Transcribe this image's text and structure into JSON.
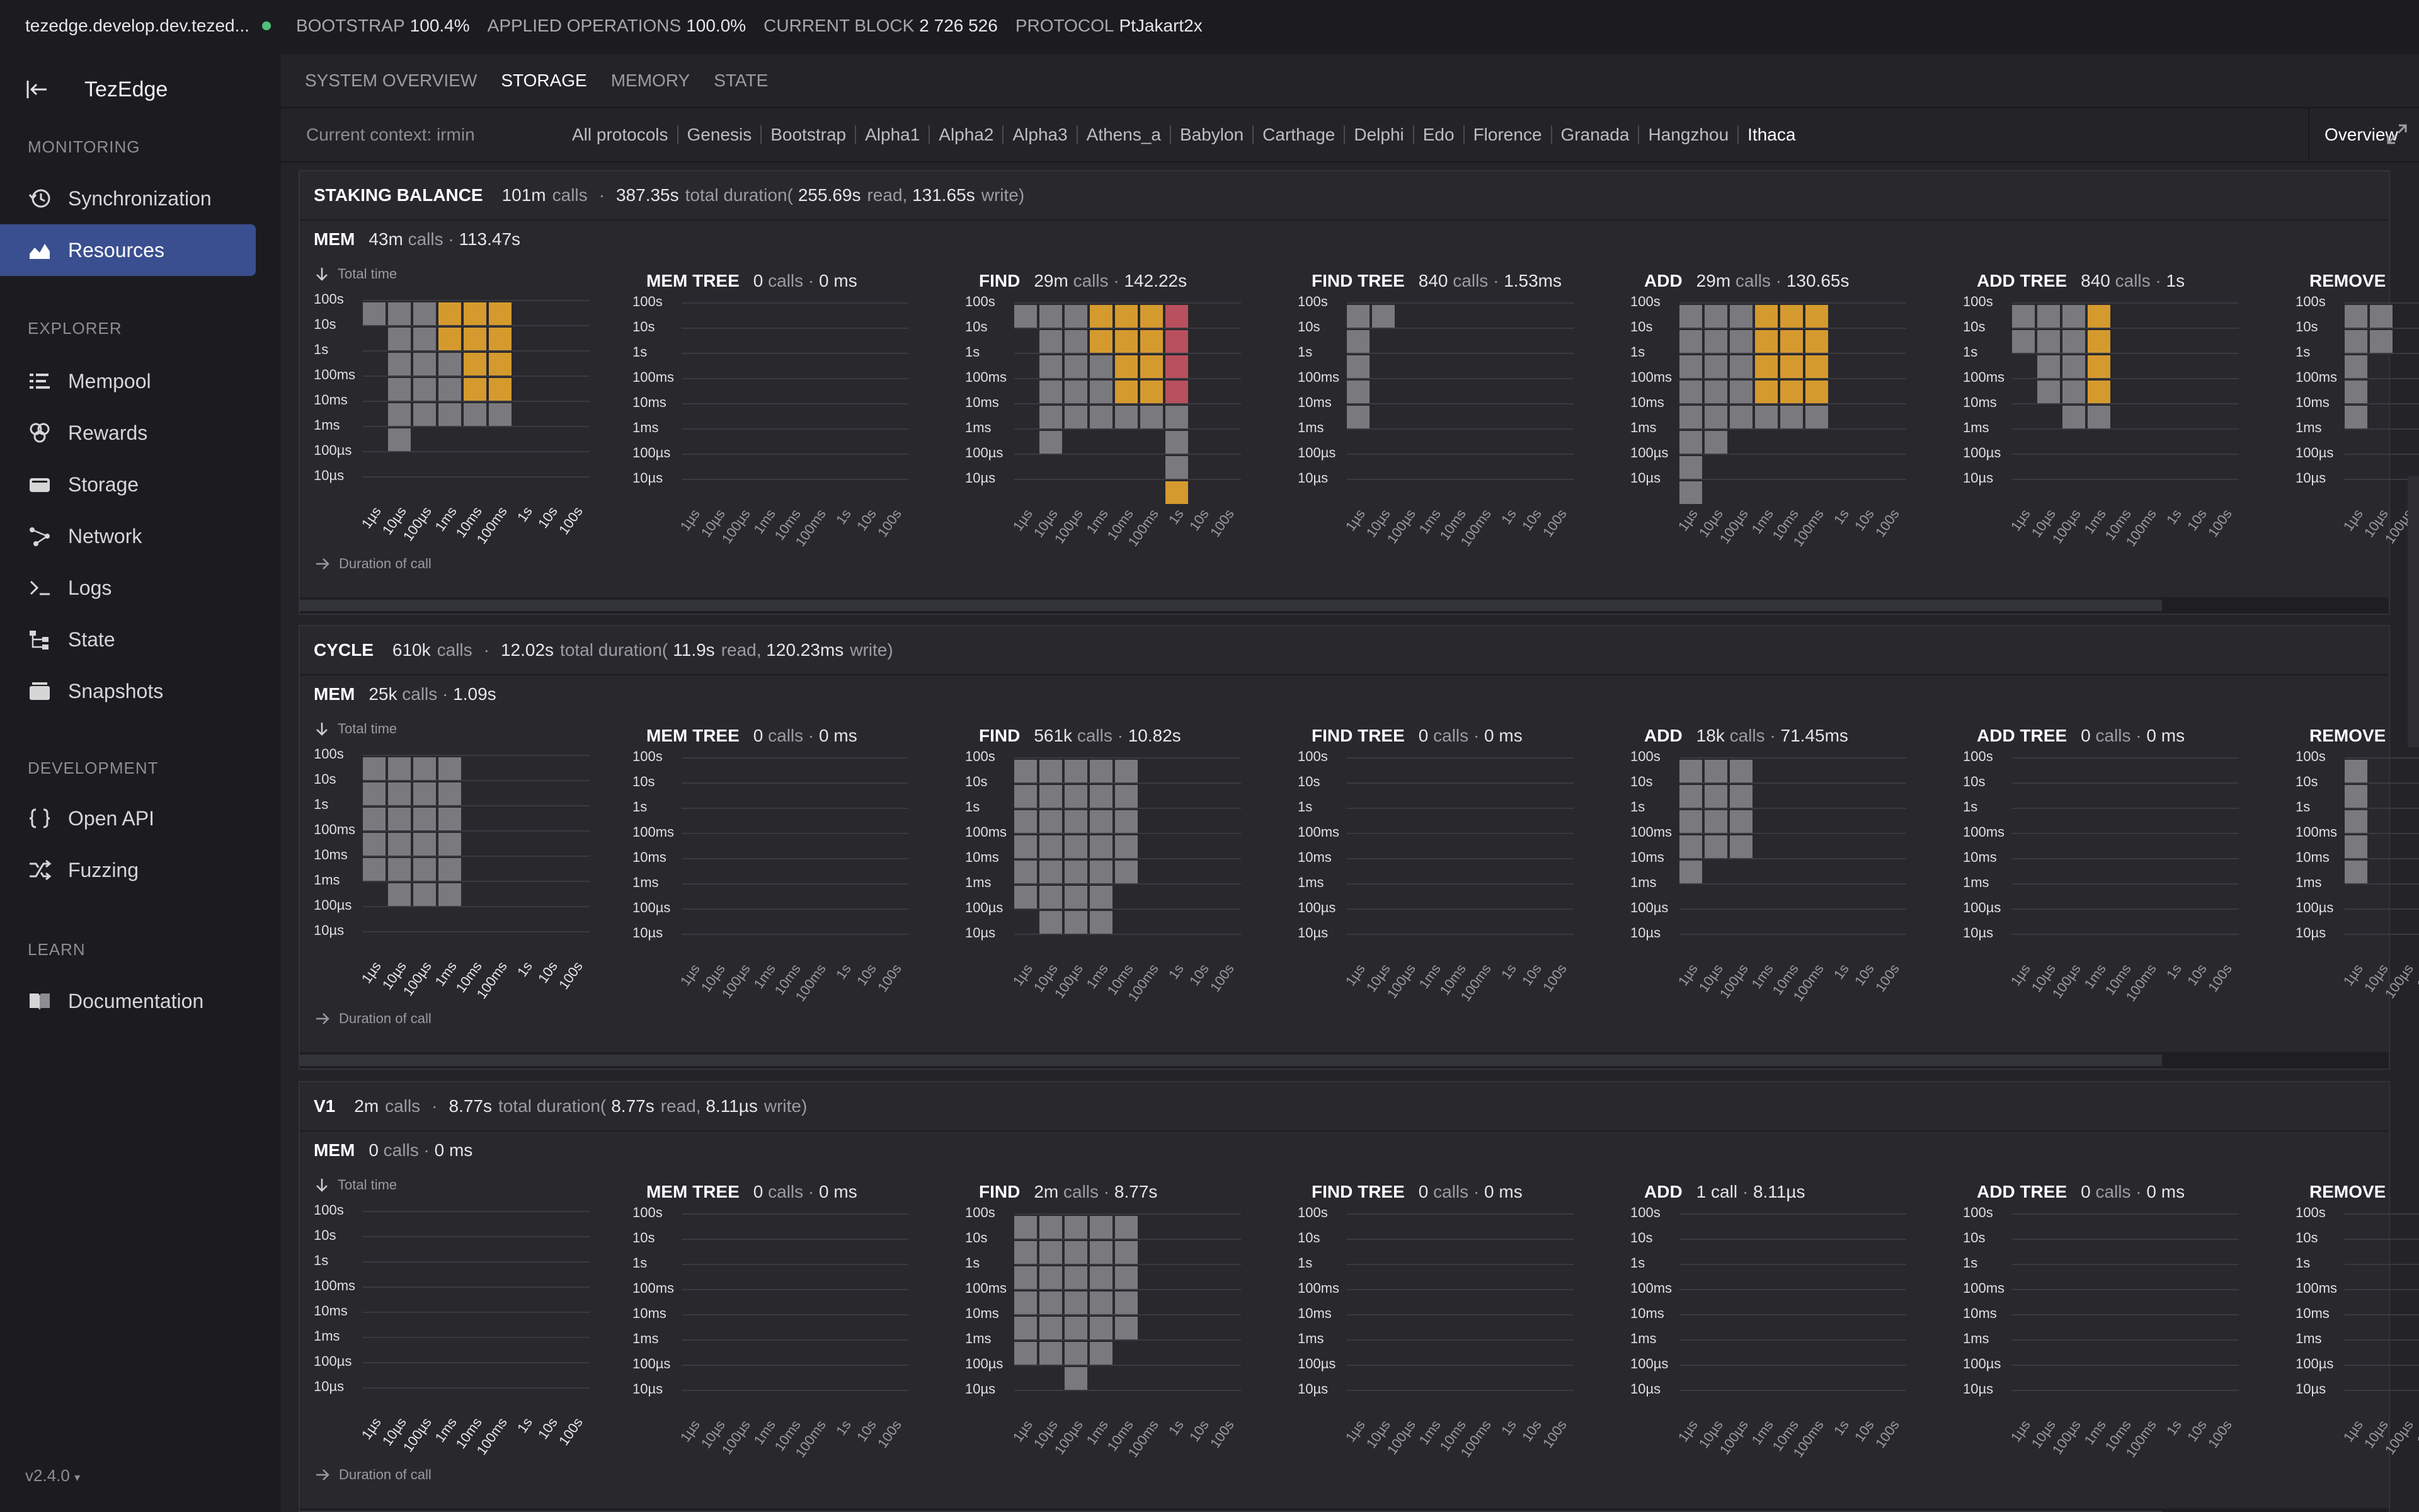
{
  "topbar": {
    "host": "tezedge.develop.dev.tezed...",
    "stats": [
      {
        "label": "BOOTSTRAP",
        "value": "100.4%"
      },
      {
        "label": "APPLIED OPERATIONS",
        "value": "100.0%"
      },
      {
        "label": "CURRENT BLOCK",
        "value": "2 726 526"
      },
      {
        "label": "PROTOCOL",
        "value": "PtJakart2x"
      }
    ]
  },
  "sidebar": {
    "brand": "TezEdge",
    "sections": [
      {
        "title": "MONITORING",
        "items": [
          {
            "label": "Synchronization",
            "icon": "history-icon"
          },
          {
            "label": "Resources",
            "icon": "area-chart-icon",
            "active": true
          }
        ]
      },
      {
        "title": "EXPLORER",
        "items": [
          {
            "label": "Mempool",
            "icon": "list-icon"
          },
          {
            "label": "Rewards",
            "icon": "coins-icon"
          },
          {
            "label": "Storage",
            "icon": "storage-icon"
          },
          {
            "label": "Network",
            "icon": "network-icon"
          },
          {
            "label": "Logs",
            "icon": "terminal-icon"
          },
          {
            "label": "State",
            "icon": "tree-icon"
          },
          {
            "label": "Snapshots",
            "icon": "snapshot-icon"
          }
        ]
      },
      {
        "title": "DEVELOPMENT",
        "items": [
          {
            "label": "Open API",
            "icon": "braces-icon"
          },
          {
            "label": "Fuzzing",
            "icon": "shuffle-icon"
          }
        ]
      },
      {
        "title": "LEARN",
        "items": [
          {
            "label": "Documentation",
            "icon": "book-icon"
          }
        ]
      }
    ],
    "version": "v2.4.0"
  },
  "tabs": [
    {
      "label": "SYSTEM OVERVIEW",
      "active": false
    },
    {
      "label": "STORAGE",
      "active": true
    },
    {
      "label": "MEMORY",
      "active": false
    },
    {
      "label": "STATE",
      "active": false
    }
  ],
  "context": {
    "label": "Current context: irmin",
    "protocols": [
      "All protocols",
      "Genesis",
      "Bootstrap",
      "Alpha1",
      "Alpha2",
      "Alpha3",
      "Athens_a",
      "Babylon",
      "Carthage",
      "Delphi",
      "Edo",
      "Florence",
      "Granada",
      "Hangzhou",
      "Ithaca"
    ],
    "overview": "Overview"
  },
  "y_labels": [
    "100s",
    "10s",
    "1s",
    "100ms",
    "10ms",
    "1ms",
    "100µs",
    "10µs"
  ],
  "x_labels": [
    "1µs",
    "10µs",
    "100µs",
    "1ms",
    "10ms",
    "100ms",
    "1s",
    "10s",
    "100s"
  ],
  "total_time_label": "Total time",
  "duration_label": "Duration of call",
  "blocks": [
    {
      "title": "STAKING BALANCE",
      "calls": "101m",
      "duration": "387.35s",
      "read": "255.69s",
      "write": "131.65s",
      "panels": [
        {
          "name": "MEM",
          "calls": "43m",
          "time": "113.47s",
          "bars": [
            [
              1,
              0,
              0,
              0,
              0,
              0,
              0,
              0
            ],
            [
              2,
              2,
              2,
              2,
              2,
              1,
              0,
              0
            ],
            [
              2,
              2,
              2,
              2,
              1,
              0,
              0,
              0
            ],
            [
              3,
              3,
              2,
              2,
              1,
              0,
              0,
              0
            ],
            [
              5,
              4,
              4,
              4,
              2,
              0,
              0,
              0
            ],
            [
              5,
              4,
              4,
              4,
              2,
              0,
              0,
              0
            ]
          ]
        },
        {
          "name": "MEM TREE",
          "calls": "0",
          "time": "0 ms",
          "bars": []
        },
        {
          "name": "FIND",
          "calls": "29m",
          "time": "142.22s",
          "bars": [
            [
              1,
              0,
              0,
              0,
              0,
              0,
              0,
              0
            ],
            [
              2,
              2,
              2,
              2,
              2,
              1,
              0,
              0
            ],
            [
              2,
              2,
              2,
              2,
              1,
              0,
              0,
              0
            ],
            [
              3,
              3,
              2,
              2,
              1,
              0,
              0,
              0
            ],
            [
              5,
              4,
              4,
              4,
              2,
              0,
              0,
              0
            ],
            [
              5,
              4,
              4,
              4,
              2,
              0,
              0,
              0
            ],
            [
              7,
              7,
              7,
              7,
              2,
              2,
              2,
              3
            ]
          ]
        },
        {
          "name": "FIND TREE",
          "calls": "840",
          "time": "1.53ms",
          "bars": [
            [
              2,
              2,
              2,
              2,
              2,
              0,
              0,
              0
            ],
            [
              1,
              0,
              0,
              0,
              0,
              0,
              0,
              0
            ]
          ]
        },
        {
          "name": "ADD",
          "calls": "29m",
          "time": "130.65s",
          "bars": [
            [
              1,
              1,
              1,
              1,
              1,
              1,
              1,
              1
            ],
            [
              2,
              2,
              2,
              2,
              2,
              1,
              0,
              0
            ],
            [
              2,
              2,
              2,
              2,
              2,
              0,
              0,
              0
            ],
            [
              3,
              3,
              3,
              3,
              2,
              0,
              0,
              0
            ],
            [
              4,
              4,
              4,
              4,
              2,
              0,
              0,
              0
            ],
            [
              5,
              5,
              4,
              4,
              2,
              0,
              0,
              0
            ]
          ]
        },
        {
          "name": "ADD TREE",
          "calls": "840",
          "time": "1s",
          "bars": [
            [
              2,
              2,
              0,
              0,
              0,
              0,
              0,
              0
            ],
            [
              2,
              2,
              2,
              2,
              0,
              0,
              0,
              0
            ],
            [
              2,
              2,
              2,
              2,
              2,
              0,
              0,
              0
            ],
            [
              4,
              4,
              4,
              4,
              2,
              0,
              0,
              0
            ]
          ]
        },
        {
          "name": "REMOVE",
          "calls": "",
          "time": "",
          "bars": [
            [
              2,
              2,
              2,
              2,
              2,
              0,
              0,
              0
            ],
            [
              2,
              2,
              0,
              0,
              0,
              0,
              0,
              0
            ]
          ]
        }
      ]
    },
    {
      "title": "CYCLE",
      "calls": "610k",
      "duration": "12.02s",
      "read": "11.9s",
      "write": "120.23ms",
      "panels": [
        {
          "name": "MEM",
          "calls": "25k",
          "time": "1.09s",
          "bars": [
            [
              2,
              2,
              2,
              2,
              2,
              0,
              0,
              0
            ],
            [
              2,
              2,
              2,
              2,
              2,
              2,
              0,
              0
            ],
            [
              2,
              2,
              2,
              2,
              2,
              2,
              0,
              0
            ],
            [
              2,
              2,
              2,
              2,
              2,
              1,
              0,
              0
            ]
          ]
        },
        {
          "name": "MEM TREE",
          "calls": "0",
          "time": "0 ms",
          "bars": []
        },
        {
          "name": "FIND",
          "calls": "561k",
          "time": "10.82s",
          "bars": [
            [
              2,
              2,
              2,
              2,
              2,
              2,
              0,
              0
            ],
            [
              2,
              2,
              2,
              2,
              2,
              2,
              2,
              0
            ],
            [
              2,
              2,
              2,
              2,
              2,
              1,
              1,
              0
            ],
            [
              2,
              2,
              2,
              2,
              2,
              1,
              1,
              0
            ],
            [
              2,
              2,
              2,
              2,
              1,
              0,
              0,
              0
            ]
          ]
        },
        {
          "name": "FIND TREE",
          "calls": "0",
          "time": "0 ms",
          "bars": []
        },
        {
          "name": "ADD",
          "calls": "18k",
          "time": "71.45ms",
          "bars": [
            [
              2,
              2,
              2,
              2,
              2,
              0,
              0,
              0
            ],
            [
              2,
              2,
              2,
              2,
              0,
              0,
              0,
              0
            ],
            [
              2,
              2,
              2,
              2,
              0,
              0,
              0,
              0
            ]
          ]
        },
        {
          "name": "ADD TREE",
          "calls": "0",
          "time": "0 ms",
          "bars": []
        },
        {
          "name": "REMOVE",
          "calls": "",
          "time": "",
          "bars": [
            [
              2,
              2,
              2,
              2,
              2,
              0,
              0,
              0
            ]
          ]
        }
      ]
    },
    {
      "title": "V1",
      "calls": "2m",
      "duration": "8.77s",
      "read": "8.77s",
      "write": "8.11µs",
      "panels": [
        {
          "name": "MEM",
          "calls": "0",
          "time": "0 ms",
          "bars": []
        },
        {
          "name": "MEM TREE",
          "calls": "0",
          "time": "0 ms",
          "bars": []
        },
        {
          "name": "FIND",
          "calls": "2m",
          "time": "8.77s",
          "bars": [
            [
              2,
              2,
              2,
              2,
              2,
              2,
              0,
              0
            ],
            [
              2,
              2,
              2,
              2,
              2,
              2,
              0,
              0
            ],
            [
              2,
              2,
              2,
              2,
              2,
              2,
              1,
              0
            ],
            [
              2,
              2,
              2,
              2,
              2,
              1,
              0,
              0
            ],
            [
              2,
              2,
              2,
              2,
              1,
              0,
              0,
              0
            ]
          ]
        },
        {
          "name": "FIND TREE",
          "calls": "0",
          "time": "0 ms",
          "bars": []
        },
        {
          "name": "ADD",
          "calls": "1 call",
          "time": "8.11µs",
          "bars": []
        },
        {
          "name": "ADD TREE",
          "calls": "0",
          "time": "0 ms",
          "bars": []
        },
        {
          "name": "REMOVE",
          "calls": "",
          "time": "",
          "bars": []
        }
      ]
    }
  ],
  "colors": {
    "grey": "#7a7a7e",
    "orange": "#d59a2e",
    "red": "#b8505e",
    "accent": "#3a4f8f"
  }
}
